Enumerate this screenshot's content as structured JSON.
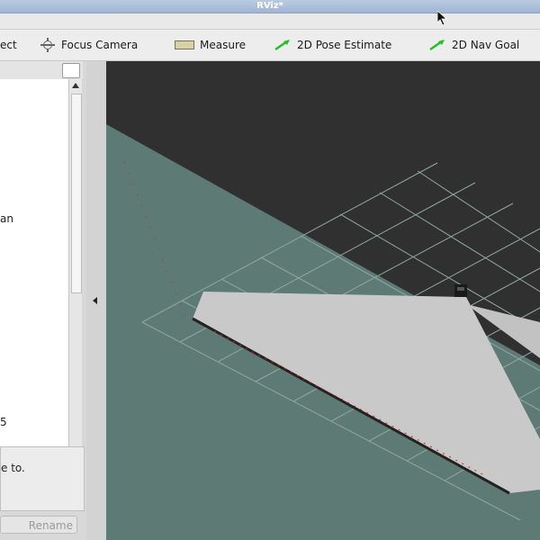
{
  "window": {
    "title": "RViz*"
  },
  "toolbar": {
    "select_label": "ect",
    "focus_camera_label": "Focus Camera",
    "measure_label": "Measure",
    "pose_estimate_label": "2D Pose Estimate",
    "nav_goal_label": "2D Nav Goal"
  },
  "sidebar": {
    "items": [
      {
        "label": "an"
      },
      {
        "label": "5"
      }
    ],
    "description_text": "e to.",
    "rename_label": "Rename"
  },
  "colors": {
    "background": "#303030",
    "ground": "#5e7a74",
    "grid": "#8fa7a2",
    "scan_area": "#c9c9c9",
    "scan_points_red": "#e41a1c",
    "pose_arrow": "#22c022"
  }
}
